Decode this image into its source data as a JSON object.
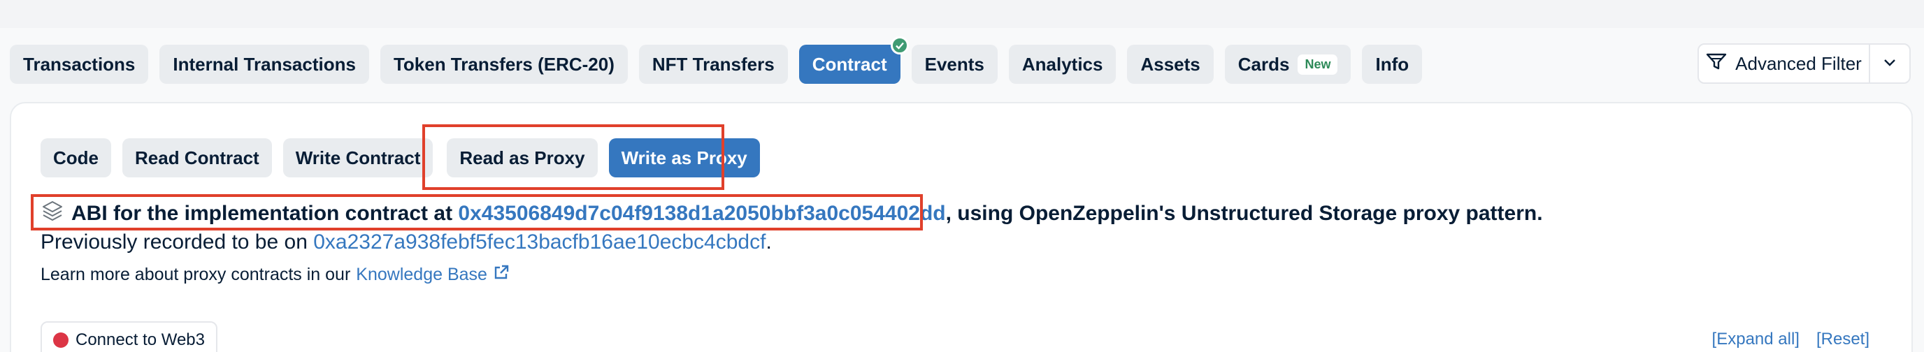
{
  "tabs": [
    {
      "label": "Transactions",
      "active": false
    },
    {
      "label": "Internal Transactions",
      "active": false
    },
    {
      "label": "Token Transfers (ERC-20)",
      "active": false
    },
    {
      "label": "NFT Transfers",
      "active": false
    },
    {
      "label": "Contract",
      "active": true,
      "verified": true
    },
    {
      "label": "Events",
      "active": false
    },
    {
      "label": "Analytics",
      "active": false
    },
    {
      "label": "Assets",
      "active": false
    },
    {
      "label": "Cards",
      "active": false,
      "badge": "New"
    },
    {
      "label": "Info",
      "active": false
    }
  ],
  "advanced_filter": {
    "label": "Advanced Filter",
    "icon": "filter-icon"
  },
  "subtabs": [
    {
      "label": "Code"
    },
    {
      "label": "Read Contract"
    },
    {
      "label": "Write Contract"
    },
    {
      "label": "Read as Proxy"
    },
    {
      "label": "Write as Proxy",
      "active": true
    }
  ],
  "abi": {
    "prefix": "ABI for the implementation contract at",
    "address": "0x43506849d7c04f9138d1a2050bbf3a0c054402dd",
    "suffix": ", using OpenZeppelin's Unstructured Storage proxy pattern."
  },
  "previous": {
    "prefix": "Previously recorded to be on",
    "address": "0xa2327a938febf5fec13bacfb16ae10ecbc4cbdcf",
    "suffix": "."
  },
  "learn_more": {
    "text": "Learn more about proxy contracts in our",
    "link": "Knowledge Base"
  },
  "connect": {
    "label": "Connect to Web3",
    "status_color": "#dc3545"
  },
  "actions": {
    "expand_all": "[Expand all]",
    "reset": "[Reset]"
  },
  "colors": {
    "accent": "#3577bf",
    "highlight": "#e0402b",
    "success": "#3f9b73"
  }
}
